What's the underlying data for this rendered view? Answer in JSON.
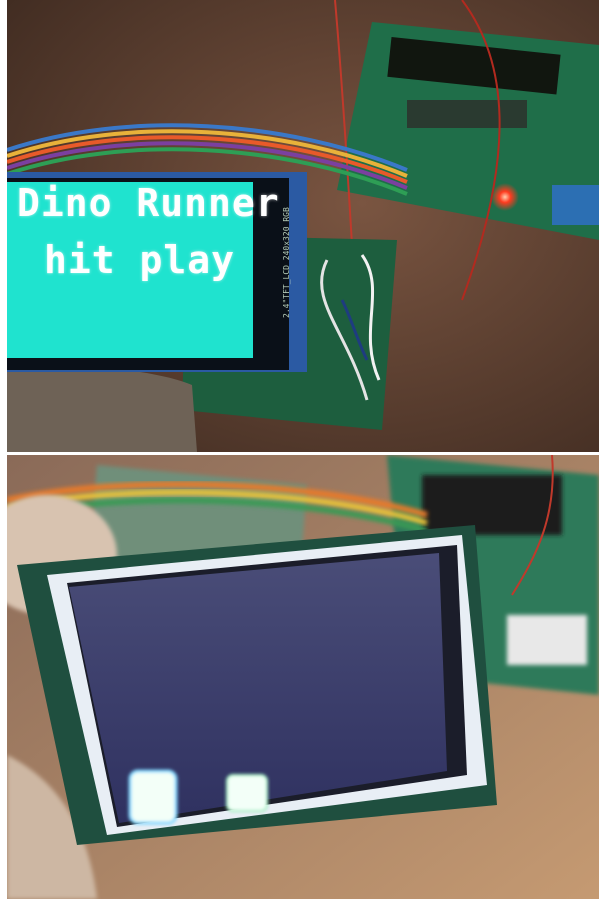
{
  "photos": [
    {
      "screen": {
        "title": "Dino Runner",
        "subtitle": "hit play",
        "silkscreen": "2.4\"TFT_LCD 240x320 RGB"
      },
      "colors": {
        "screen_bg": "#1fe3cf",
        "table": "#6b4a37",
        "pcb": "#1f6e49",
        "led": "#ff3b1f"
      }
    },
    {
      "screen": {
        "state": "dark",
        "tiles": 2
      },
      "colors": {
        "screen_bg": "#3a3d6a",
        "tile": "#f3fff8",
        "table": "#8a6a58",
        "pcb": "#2f7a5a"
      }
    }
  ]
}
